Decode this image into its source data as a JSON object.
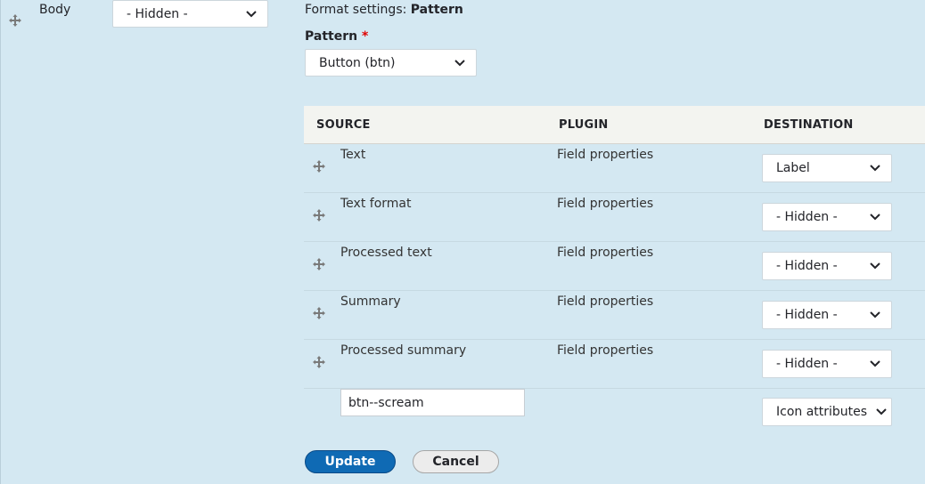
{
  "field": {
    "label": "Body",
    "format_select": "- Hidden -"
  },
  "format_settings": {
    "prefix": "Format settings:",
    "value": "Pattern"
  },
  "pattern": {
    "label": "Pattern",
    "required_mark": "*",
    "selected": "Button (btn)"
  },
  "table": {
    "headers": {
      "source": "SOURCE",
      "plugin": "PLUGIN",
      "destination": "DESTINATION"
    },
    "rows": [
      {
        "source": "Text",
        "plugin": "Field properties",
        "destination": "Label"
      },
      {
        "source": "Text format",
        "plugin": "Field properties",
        "destination": "- Hidden -"
      },
      {
        "source": "Processed text",
        "plugin": "Field properties",
        "destination": "- Hidden -"
      },
      {
        "source": "Summary",
        "plugin": "Field properties",
        "destination": "- Hidden -"
      },
      {
        "source": "Processed summary",
        "plugin": "Field properties",
        "destination": "- Hidden -"
      }
    ],
    "extra_row": {
      "input_value": "btn--scream",
      "destination": "Icon attributes"
    }
  },
  "actions": {
    "update": "Update",
    "cancel": "Cancel"
  },
  "colors": {
    "background": "#d4e8f2",
    "primary_button": "#0f6ab4",
    "required": "#e00000"
  }
}
